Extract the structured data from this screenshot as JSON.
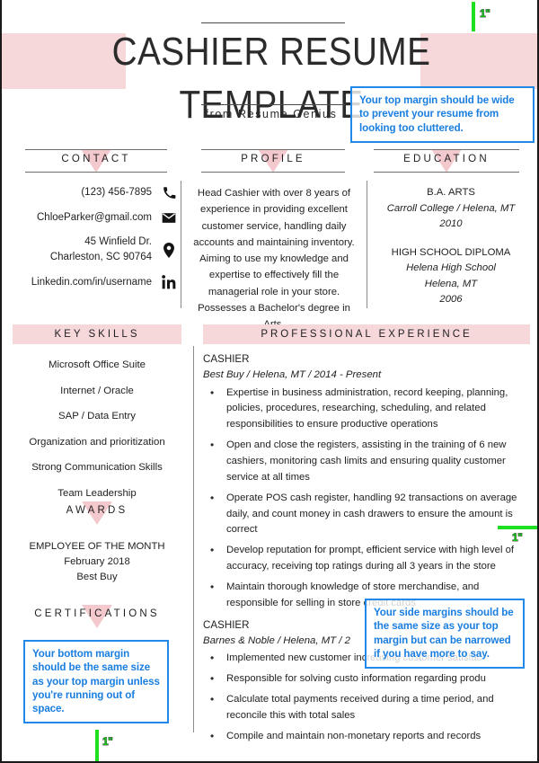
{
  "header": {
    "title": "CASHIER RESUME TEMPLATE",
    "subtitle": "from Resume Genius"
  },
  "sections": {
    "contact": "CONTACT",
    "profile": "PROFILE",
    "education": "EDUCATION",
    "key_skills": "KEY SKILLS",
    "professional_experience": "PROFESSIONAL EXPERIENCE",
    "awards": "AWARDS",
    "certifications": "CERTIFICATIONS"
  },
  "contact": {
    "items": [
      {
        "value": "(123) 456-7895",
        "icon": "phone-icon"
      },
      {
        "value": "ChloeParker@gmail.com",
        "icon": "envelope-icon"
      },
      {
        "value": "45 Winfield Dr.\nCharleston, SC 90764",
        "icon": "location-pin-icon"
      },
      {
        "value": "Linkedin.com/in/username",
        "icon": "linkedin-icon"
      }
    ]
  },
  "profile": {
    "text": "Head Cashier with over 8 years of experience in providing excellent customer service, handling daily accounts and maintaining inventory. Aiming to use my knowledge and expertise to effectively fill the managerial role in your store. Possesses a Bachelor's degree in Arts."
  },
  "education": {
    "entries": [
      {
        "degree": "B.A. ARTS",
        "school": "Carroll College / Helena, MT",
        "year": "2010"
      },
      {
        "degree": "HIGH SCHOOL DIPLOMA",
        "school": "Helena High School",
        "school2": "Helena, MT",
        "year": "2006"
      }
    ]
  },
  "key_skills": {
    "items": [
      "Microsoft Office Suite",
      "Internet / Oracle",
      "SAP / Data Entry",
      "Organization and prioritization",
      "Strong Communication Skills",
      "Team Leadership"
    ]
  },
  "awards": {
    "title": "EMPLOYEE OF THE MONTH",
    "date": "February 2018",
    "company": "Best Buy"
  },
  "experience": {
    "jobs": [
      {
        "title": "CASHIER",
        "meta": "Best Buy  /  Helena, MT  /  2014 - Present",
        "bullets": [
          "Expertise in business administration, record keeping, planning, policies, procedures, researching, scheduling, and related responsibilities to ensure productive operations",
          "Open and close the registers, assisting in the training of 6 new cashiers, monitoring cash limits and ensuring quality customer service at all times",
          "Operate POS cash register, handling 92 transactions on average daily, and count money in cash drawers to ensure the amount is correct",
          "Develop reputation for prompt, efficient service with high level of accuracy, receiving top ratings during all 3 years in the store",
          "Maintain thorough knowledge of store merchandise, and responsible for selling in store credit cards"
        ]
      },
      {
        "title": "CASHIER",
        "meta": "Barnes & Noble  /  Helena, MT  /  2",
        "bullets": [
          "Implemented new customer increasing customer satisfac",
          "Responsible for solving custo information regarding produ",
          "Calculate total payments received during a time period, and reconcile this with total sales",
          "Compile and maintain non-monetary reports and records"
        ]
      }
    ]
  },
  "annotations": {
    "top": "Your top margin should be wide to prevent your resume from looking too cluttered.",
    "side": "Your side margins should be the same size as your top margin but can be narrowed if you have more to say.",
    "bottom": "Your bottom margin should be the same size as your top margin unless you're running out of space."
  },
  "margin_markers": {
    "top": "1\"",
    "right": "1\"",
    "bottom": "1\""
  },
  "colors": {
    "pink": "#f6d7da",
    "pink_triangle": "#f3c9ce",
    "annotation_blue": "#2389e8",
    "marker_green": "#1fe01f"
  }
}
